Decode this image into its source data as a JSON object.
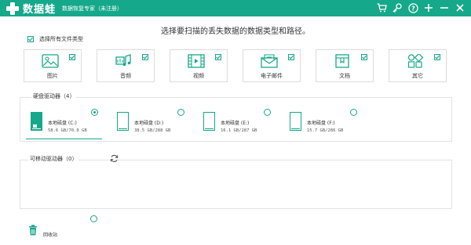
{
  "app": {
    "logo_text": "数据蛙",
    "title": "数据恢复专家（未注册）"
  },
  "titlebar_icons": [
    "cart-icon",
    "key-icon",
    "help-icon",
    "plus-icon",
    "minimize-icon",
    "close-icon"
  ],
  "heading": "选择要扫描的丢失数据的数据类型和路径。",
  "select_all_label": "选择所有文件类型",
  "file_types": [
    {
      "label": "图片",
      "icon": "image-icon",
      "checked": true
    },
    {
      "label": "音频",
      "icon": "audio-icon",
      "checked": true
    },
    {
      "label": "视频",
      "icon": "video-icon",
      "checked": true
    },
    {
      "label": "电子邮件",
      "icon": "email-icon",
      "checked": true
    },
    {
      "label": "文档",
      "icon": "document-icon",
      "checked": true
    },
    {
      "label": "其它",
      "icon": "other-icon",
      "checked": true
    }
  ],
  "hard_drives": {
    "title": "硬盘驱动器（4）",
    "drives": [
      {
        "name": "本地磁盘 (C:)",
        "size": "58.6 GB/70.0 GB",
        "selected": true
      },
      {
        "name": "本地磁盘 (D:)",
        "size": "38.5 GB/288 GB",
        "selected": false
      },
      {
        "name": "本地磁盘 (E:)",
        "size": "16.1 GB/287 GB",
        "selected": false
      },
      {
        "name": "本地磁盘 (F:)",
        "size": "15.7 GB/286 GB",
        "selected": false
      }
    ]
  },
  "removable": {
    "title": "可移动驱动器（0）"
  },
  "recycle_bin": {
    "label": "回收站"
  },
  "colors": {
    "accent": "#16a88a",
    "border": "#dcdcdc"
  }
}
